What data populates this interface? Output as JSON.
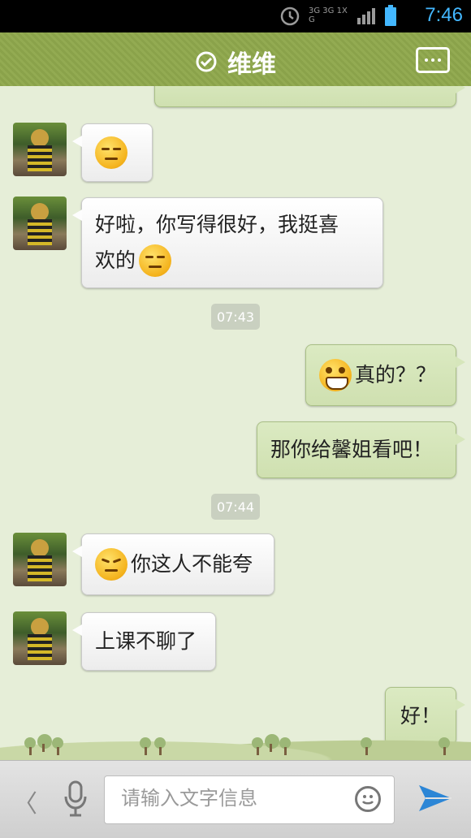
{
  "status_bar": {
    "time": "7:46",
    "network": "3G 3G 1X G"
  },
  "header": {
    "contact_name": "维维"
  },
  "messages": [
    {
      "from": "left",
      "text": "",
      "emoji": "squint-sweat-face"
    },
    {
      "from": "left",
      "text": "好啦，你写得很好，我挺喜",
      "text2": "欢的",
      "emoji": "smiling-face"
    },
    {
      "timestamp": "07:43"
    },
    {
      "from": "right",
      "text": "真的？？",
      "emoji": "grinning-face"
    },
    {
      "from": "right",
      "text": "那你给馨姐看吧！"
    },
    {
      "timestamp": "07:44"
    },
    {
      "from": "left",
      "text": "你这人不能夸",
      "emoji": "angry-face"
    },
    {
      "from": "left",
      "text": "上课不聊了"
    },
    {
      "from": "right",
      "text": "好！"
    }
  ],
  "input_bar": {
    "placeholder": "请输入文字信息",
    "back_glyph": "〈"
  },
  "colors": {
    "header": "#8aa24a",
    "clock": "#43b7ff",
    "right_bubble": "#d6e6bb"
  }
}
